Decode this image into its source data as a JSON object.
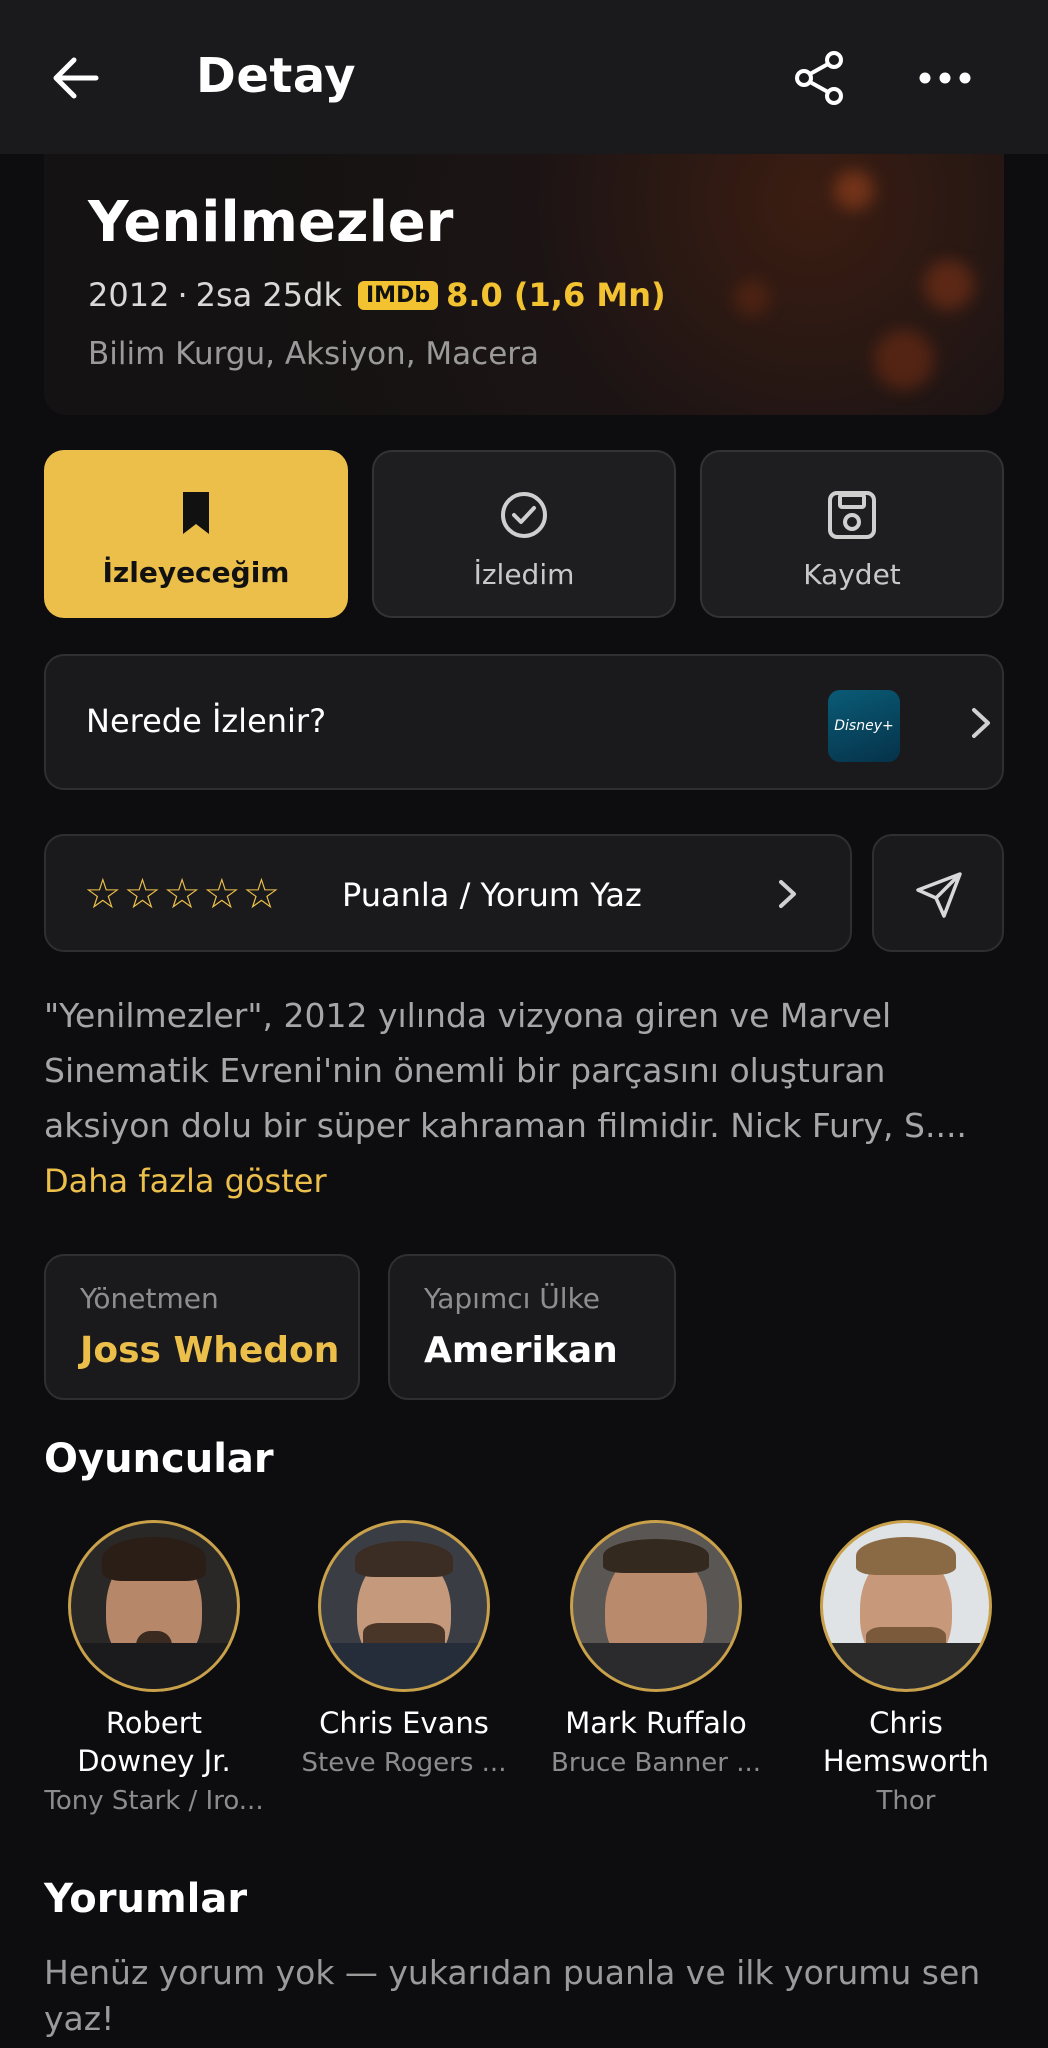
{
  "header": {
    "title": "Detay",
    "back_icon": "arrow-left-icon",
    "share_icon": "share-icon",
    "more_icon": "more-horizontal-icon"
  },
  "movie": {
    "title": "Yenilmezler",
    "year": "2012",
    "separator": "·",
    "duration": "2sa 25dk",
    "imdb_label": "IMDb",
    "imdb_score": "8.0 (1,6 Mn)",
    "genres": "Bilim Kurgu, Aksiyon, Macera"
  },
  "actions": [
    {
      "label": "İzleyeceğim",
      "icon": "bookmark-icon",
      "active": true
    },
    {
      "label": "İzledim",
      "icon": "check-circle-icon",
      "active": false
    },
    {
      "label": "Kaydet",
      "icon": "save-icon",
      "active": false
    }
  ],
  "where_to_watch": {
    "label": "Nerede İzlenir?",
    "provider": "Disney+",
    "provider_logo_text": "Disney+"
  },
  "rating": {
    "stars": "☆☆☆☆☆",
    "label": "Puanla / Yorum Yaz"
  },
  "description": {
    "text": "\"Yenilmezler\", 2012 yılında vizyona giren ve Marvel Sinematik Evreni'nin önemli bir parçasını oluşturan aksiyon dolu bir süper kahraman filmidir. Nick Fury, S....",
    "more_label": "Daha fazla göster"
  },
  "info": {
    "director_label": "Yönetmen",
    "director": "Joss Whedon",
    "country_label": "Yapımcı Ülke",
    "country": "Amerikan"
  },
  "cast": {
    "title": "Oyuncular",
    "members": [
      {
        "name": "Robert Downey Jr.",
        "role": "Tony Stark / Iro..."
      },
      {
        "name": "Chris Evans",
        "role": "Steve Rogers ..."
      },
      {
        "name": "Mark Ruffalo",
        "role": "Bruce Banner ..."
      },
      {
        "name": "Chris Hemsworth",
        "role": "Thor"
      }
    ]
  },
  "reviews": {
    "title": "Yorumlar",
    "empty_text": "Henüz yorum yok — yukarıdan puanla ve ilk yorumu sen yaz!"
  },
  "colors": {
    "accent": "#ECBF4B",
    "background": "#0D0D0F",
    "card": "#1A1A1D",
    "topbar": "#1A1A1C"
  }
}
